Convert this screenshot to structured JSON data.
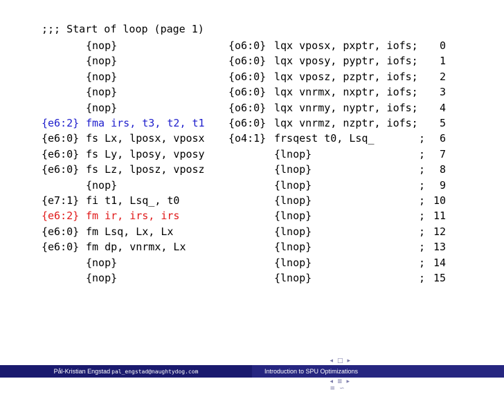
{
  "title": ";;; Start of loop (page 1)",
  "lines": [
    {
      "left_slot": "",
      "left_instr": "{nop}",
      "left_color": "black",
      "right_slot": "{o6:0}",
      "right_instr": "lqx vposx, pxptr, iofs;",
      "semi": "",
      "num": "0"
    },
    {
      "left_slot": "",
      "left_instr": "{nop}",
      "left_color": "black",
      "right_slot": "{o6:0}",
      "right_instr": "lqx vposy, pyptr, iofs;",
      "semi": "",
      "num": "1"
    },
    {
      "left_slot": "",
      "left_instr": "{nop}",
      "left_color": "black",
      "right_slot": "{o6:0}",
      "right_instr": "lqx vposz, pzptr, iofs;",
      "semi": "",
      "num": "2"
    },
    {
      "left_slot": "",
      "left_instr": "{nop}",
      "left_color": "black",
      "right_slot": "{o6:0}",
      "right_instr": "lqx vnrmx, nxptr, iofs;",
      "semi": "",
      "num": "3"
    },
    {
      "left_slot": "",
      "left_instr": "{nop}",
      "left_color": "black",
      "right_slot": "{o6:0}",
      "right_instr": "lqx vnrmy, nyptr, iofs;",
      "semi": "",
      "num": "4"
    },
    {
      "left_slot": "{e6:2}",
      "left_instr": "fma irs, t3, t2, t1",
      "left_color": "blue",
      "right_slot": "{o6:0}",
      "right_instr": "lqx vnrmz, nzptr, iofs;",
      "semi": "",
      "num": "5"
    },
    {
      "left_slot": "{e6:0}",
      "left_instr": "fs Lx, lposx, vposx",
      "left_color": "black",
      "right_slot": "{o4:1}",
      "right_instr": "frsqest t0, Lsq_",
      "semi": ";",
      "num": "6"
    },
    {
      "left_slot": "{e6:0}",
      "left_instr": "fs Ly, lposy, vposy",
      "left_color": "black",
      "right_slot": "",
      "right_instr": "{lnop}",
      "semi": ";",
      "num": "7"
    },
    {
      "left_slot": "{e6:0}",
      "left_instr": "fs Lz, lposz, vposz",
      "left_color": "black",
      "right_slot": "",
      "right_instr": "{lnop}",
      "semi": ";",
      "num": "8"
    },
    {
      "left_slot": "",
      "left_instr": "{nop}",
      "left_color": "black",
      "right_slot": "",
      "right_instr": "{lnop}",
      "semi": ";",
      "num": "9"
    },
    {
      "left_slot": "{e7:1}",
      "left_instr": "fi t1, Lsq_, t0",
      "left_color": "black",
      "right_slot": "",
      "right_instr": "{lnop}",
      "semi": ";",
      "num": "10"
    },
    {
      "left_slot": "{e6:2}",
      "left_instr": "fm ir, irs, irs",
      "left_color": "red",
      "right_slot": "",
      "right_instr": "{lnop}",
      "semi": ";",
      "num": "11"
    },
    {
      "left_slot": "{e6:0}",
      "left_instr": "fm Lsq, Lx, Lx",
      "left_color": "black",
      "right_slot": "",
      "right_instr": "{lnop}",
      "semi": ";",
      "num": "12"
    },
    {
      "left_slot": "{e6:0}",
      "left_instr": "fm dp, vnrmx, Lx",
      "left_color": "black",
      "right_slot": "",
      "right_instr": "{lnop}",
      "semi": ";",
      "num": "13"
    },
    {
      "left_slot": "",
      "left_instr": "{nop}",
      "left_color": "black",
      "right_slot": "",
      "right_instr": "{lnop}",
      "semi": ";",
      "num": "14"
    },
    {
      "left_slot": "",
      "left_instr": "{nop}",
      "left_color": "black",
      "right_slot": "",
      "right_instr": "{lnop}",
      "semi": ";",
      "num": "15"
    }
  ],
  "colors": {
    "blue": "#1d1dcc",
    "red": "#e01818",
    "black": "#000000",
    "footer_left_bg": "#1a1a6e",
    "footer_right_bg": "#262680"
  },
  "nav": {
    "icons": [
      "nav-left-arrow-icon",
      "nav-frame-icon",
      "nav-right-arrow-icon",
      "nav-left-arrow-icon",
      "nav-section-icon",
      "nav-right-arrow-icon",
      "nav-left-arrow-icon",
      "nav-subsection-icon",
      "nav-right-arrow-icon",
      "nav-left-arrow-icon",
      "nav-slide-icon",
      "nav-right-arrow-icon",
      "nav-align-icon",
      "nav-search-icon"
    ]
  },
  "footer": {
    "author": "Pål-Kristian Engstad",
    "email": "pal_engstad@naughtydog.com",
    "title": "Introduction to SPU Optimizations"
  }
}
